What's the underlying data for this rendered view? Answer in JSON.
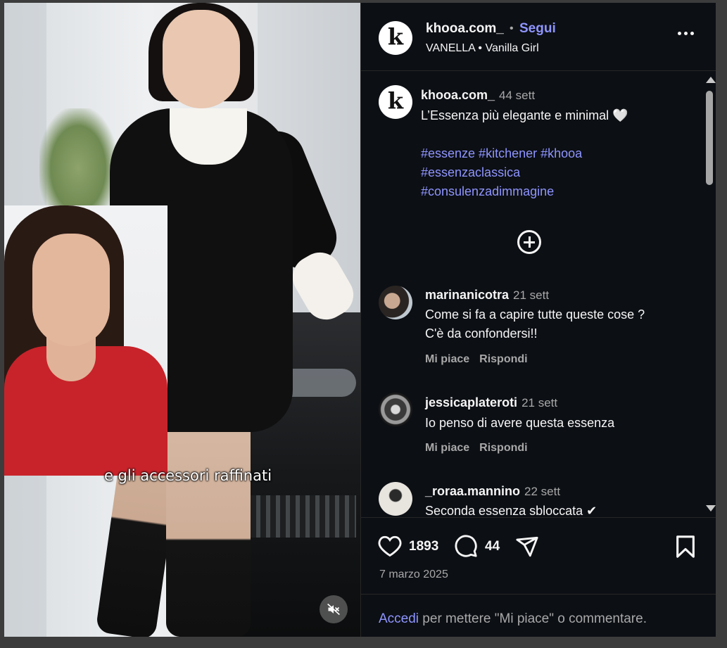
{
  "header": {
    "username": "khooa.com_",
    "follow_label": "Segui",
    "separator": "•",
    "audio_artist": "VANELLA",
    "audio_title": "Vanilla Girl",
    "avatar_letter": "k"
  },
  "media": {
    "caption": "e gli accessori raffinati",
    "mute_icon": "speaker-muted-icon"
  },
  "post": {
    "username": "khooa.com_",
    "time": "44 sett",
    "text": "L’Essenza più elegante e minimal 🤍",
    "hashtags": [
      "#essenze #kitchener #khooa",
      "#essenzaclassica",
      "#consulenzadimmagine"
    ]
  },
  "comments": [
    {
      "username": "marinanicotra",
      "time": "21 sett",
      "text_lines": [
        "Come si fa a capire tutte queste cose ?",
        "C'è da confondersi!!"
      ],
      "like_label": "Mi piace",
      "reply_label": "Rispondi"
    },
    {
      "username": "jessicaplateroti",
      "time": "21 sett",
      "text_lines": [
        "Io penso di avere questa essenza"
      ],
      "like_label": "Mi piace",
      "reply_label": "Rispondi"
    },
    {
      "username": "_roraa.mannino",
      "time": "22 sett",
      "text_lines": [
        "Seconda essenza sbloccata ✔"
      ]
    }
  ],
  "stats": {
    "likes": "1893",
    "comments": "44",
    "date": "7 marzo 2025"
  },
  "login_prompt": {
    "link": "Accedi",
    "text": " per mettere \"Mi piace\" o commentare."
  },
  "colors": {
    "accent": "#8f95ff",
    "panel_bg": "#0c0f14",
    "secondary_text": "#a8a8a8"
  }
}
